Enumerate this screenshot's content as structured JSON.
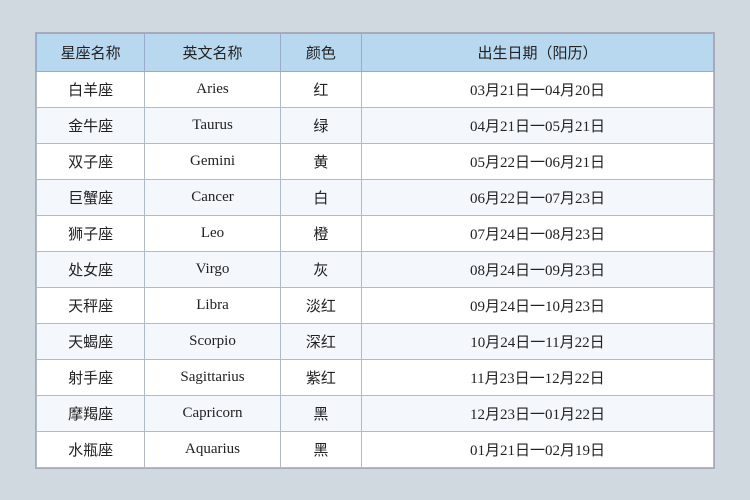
{
  "table": {
    "headers": [
      "星座名称",
      "英文名称",
      "颜色",
      "出生日期（阳历）"
    ],
    "rows": [
      {
        "zh": "白羊座",
        "en": "Aries",
        "color": "红",
        "date": "03月21日一04月20日"
      },
      {
        "zh": "金牛座",
        "en": "Taurus",
        "color": "绿",
        "date": "04月21日一05月21日"
      },
      {
        "zh": "双子座",
        "en": "Gemini",
        "color": "黄",
        "date": "05月22日一06月21日"
      },
      {
        "zh": "巨蟹座",
        "en": "Cancer",
        "color": "白",
        "date": "06月22日一07月23日"
      },
      {
        "zh": "狮子座",
        "en": "Leo",
        "color": "橙",
        "date": "07月24日一08月23日"
      },
      {
        "zh": "处女座",
        "en": "Virgo",
        "color": "灰",
        "date": "08月24日一09月23日"
      },
      {
        "zh": "天秤座",
        "en": "Libra",
        "color": "淡红",
        "date": "09月24日一10月23日"
      },
      {
        "zh": "天蝎座",
        "en": "Scorpio",
        "color": "深红",
        "date": "10月24日一11月22日"
      },
      {
        "zh": "射手座",
        "en": "Sagittarius",
        "color": "紫红",
        "date": "11月23日一12月22日"
      },
      {
        "zh": "摩羯座",
        "en": "Capricorn",
        "color": "黑",
        "date": "12月23日一01月22日"
      },
      {
        "zh": "水瓶座",
        "en": "Aquarius",
        "color": "黑",
        "date": "01月21日一02月19日"
      }
    ]
  }
}
